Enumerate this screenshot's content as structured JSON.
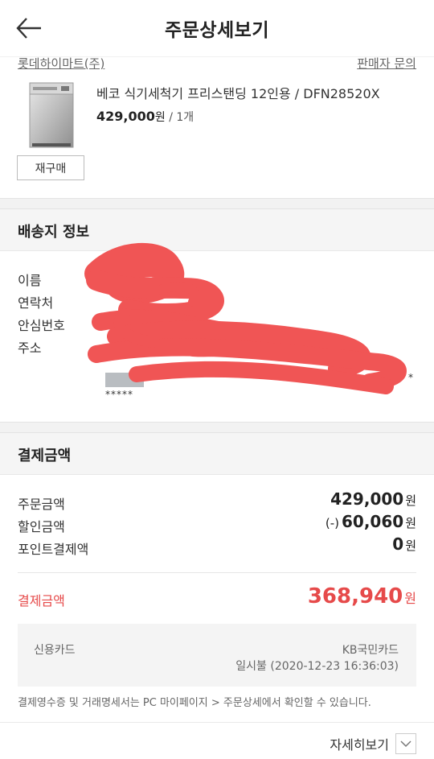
{
  "header": {
    "title": "주문상세보기",
    "back_icon": "arrow-left-icon"
  },
  "seller": {
    "name": "롯데하이마트(주)",
    "contact_label": "판매자 문의"
  },
  "product": {
    "name": "베코 식기세척기 프리스탠딩 12인용 / DFN28520X",
    "price": "429,000",
    "price_unit": "원",
    "quantity": " / 1개",
    "rebuy_label": "재구매"
  },
  "shipping": {
    "title": "배송지 정보",
    "labels": {
      "name": "이름",
      "contact": "연락처",
      "safe_number": "안심번호",
      "address": "주소"
    },
    "safe_number_value": "-",
    "address_masked_1": "*****",
    "address_masked_2": "*",
    "address_masked_3": "*****"
  },
  "payment": {
    "title": "결제금액",
    "order_amount_label": "주문금액",
    "order_amount": "429,000",
    "discount_label": "할인금액",
    "discount_prefix": "(-)",
    "discount_amount": "60,060",
    "points_label": "포인트결제액",
    "points_amount": "0",
    "won": "원",
    "total_label": "결제금액",
    "total_amount": "368,940",
    "method_type": "신용카드",
    "card_name": "KB국민카드",
    "card_detail": "일시불 (2020-12-23 16:36:03)"
  },
  "notice": "결제영수증 및 거래명세서는 PC 마이페이지 > 주문상세에서 확인할 수 있습니다.",
  "more": {
    "label": "자세히보기",
    "icon": "chevron-down-icon"
  },
  "colors": {
    "accent": "#e64a4a",
    "redaction": "#f05555"
  }
}
